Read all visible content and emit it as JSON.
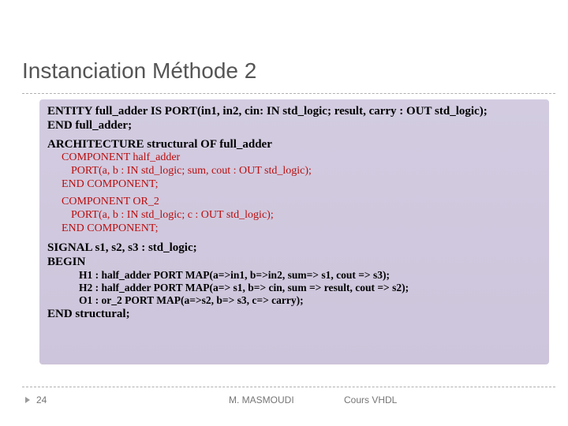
{
  "slide": {
    "title": "Instanciation Méthode 2",
    "code": {
      "entity_l1": "ENTITY full_adder IS  PORT(in1, in2, cin: IN std_logic; result, carry : OUT std_logic);",
      "entity_l2": "END full_adder;",
      "arch_l1": "ARCHITECTURE structural OF full_adder",
      "comp1_l1": "COMPONENT half_adder",
      "comp1_l2": "PORT(a, b : IN std_logic; sum, cout : OUT std_logic);",
      "comp1_l3": "END COMPONENT;",
      "comp2_l1": "COMPONENT OR_2",
      "comp2_l2": "PORT(a, b : IN std_logic; c : OUT std_logic);",
      "comp2_l3": "END COMPONENT;",
      "sig_l1": "SIGNAL s1, s2, s3 : std_logic;",
      "begin_l1": "BEGIN",
      "map1": "H1 : half_adder  PORT MAP(a=>in1, b=>in2, sum=> s1, cout => s3);",
      "map2": "H2 : half_adder  PORT MAP(a=> s1, b=> cin, sum => result, cout => s2);",
      "map3": "O1 : or_2  PORT MAP(a=>s2, b=> s3, c=> carry);",
      "end_l1": "END structural;"
    },
    "footer": {
      "page": "24",
      "author": "M. MASMOUDI",
      "course": "Cours VHDL"
    }
  }
}
